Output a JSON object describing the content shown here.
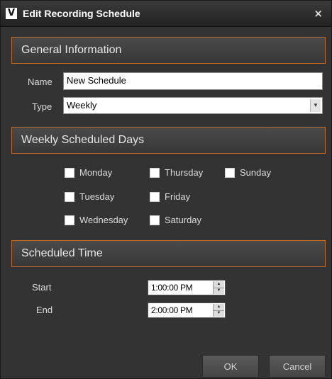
{
  "window": {
    "title": "Edit Recording Schedule",
    "logo_glyph": "V",
    "close_glyph": "×"
  },
  "general": {
    "header": "General Information",
    "name_label": "Name",
    "name_value": "New Schedule",
    "type_label": "Type",
    "type_value": "Weekly",
    "dropdown_glyph": "▼"
  },
  "weekly": {
    "header": "Weekly Scheduled Days",
    "days": {
      "monday": "Monday",
      "tuesday": "Tuesday",
      "wednesday": "Wednesday",
      "thursday": "Thursday",
      "friday": "Friday",
      "saturday": "Saturday",
      "sunday": "Sunday"
    }
  },
  "time": {
    "header": "Scheduled Time",
    "start_label": "Start",
    "start_value": "1:00:00 PM",
    "end_label": "End",
    "end_value": "2:00:00 PM",
    "spin_up": "▲",
    "spin_down": "▼"
  },
  "buttons": {
    "ok": "OK",
    "cancel": "Cancel"
  },
  "colors": {
    "accent_border": "#c06a2a",
    "background": "#333333"
  }
}
